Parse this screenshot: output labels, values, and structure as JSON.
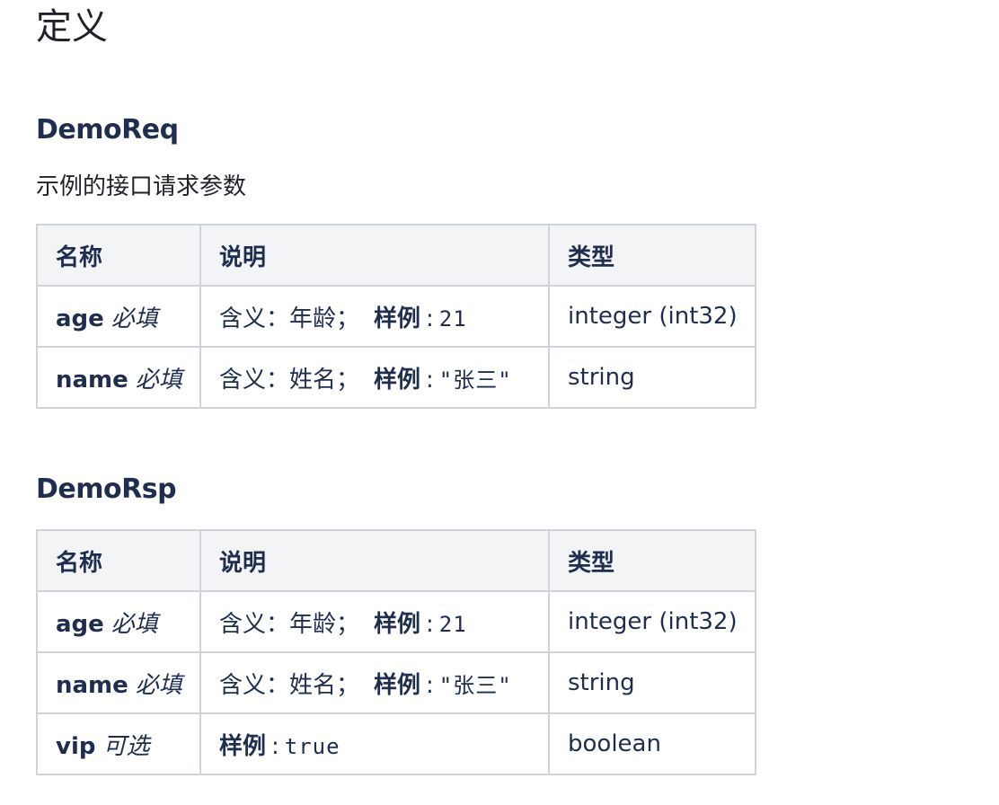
{
  "page": {
    "title": "定义"
  },
  "sections": [
    {
      "title": "DemoReq",
      "description": "示例的接口请求参数",
      "headers": [
        "名称",
        "说明",
        "类型"
      ],
      "rows": [
        {
          "name": "age",
          "required": "必填",
          "desc_label": "含义：年龄；",
          "example_label": "样例",
          "example_value": "21",
          "type": "integer (int32)"
        },
        {
          "name": "name",
          "required": "必填",
          "desc_label": "含义：姓名；",
          "example_label": "样例",
          "example_value": "\"张三\"",
          "type": "string"
        }
      ]
    },
    {
      "title": "DemoRsp",
      "description": "",
      "headers": [
        "名称",
        "说明",
        "类型"
      ],
      "rows": [
        {
          "name": "age",
          "required": "必填",
          "desc_label": "含义：年龄；",
          "example_label": "样例",
          "example_value": "21",
          "type": "integer (int32)"
        },
        {
          "name": "name",
          "required": "必填",
          "desc_label": "含义：姓名；",
          "example_label": "样例",
          "example_value": "\"张三\"",
          "type": "string"
        },
        {
          "name": "vip",
          "required": "可选",
          "desc_label": "",
          "example_label": "样例",
          "example_value": "true",
          "type": "boolean"
        }
      ]
    }
  ],
  "colors": {
    "heading": "#1f2d4f",
    "header_bg": "#f3f4f6",
    "border": "#d0d4da"
  }
}
